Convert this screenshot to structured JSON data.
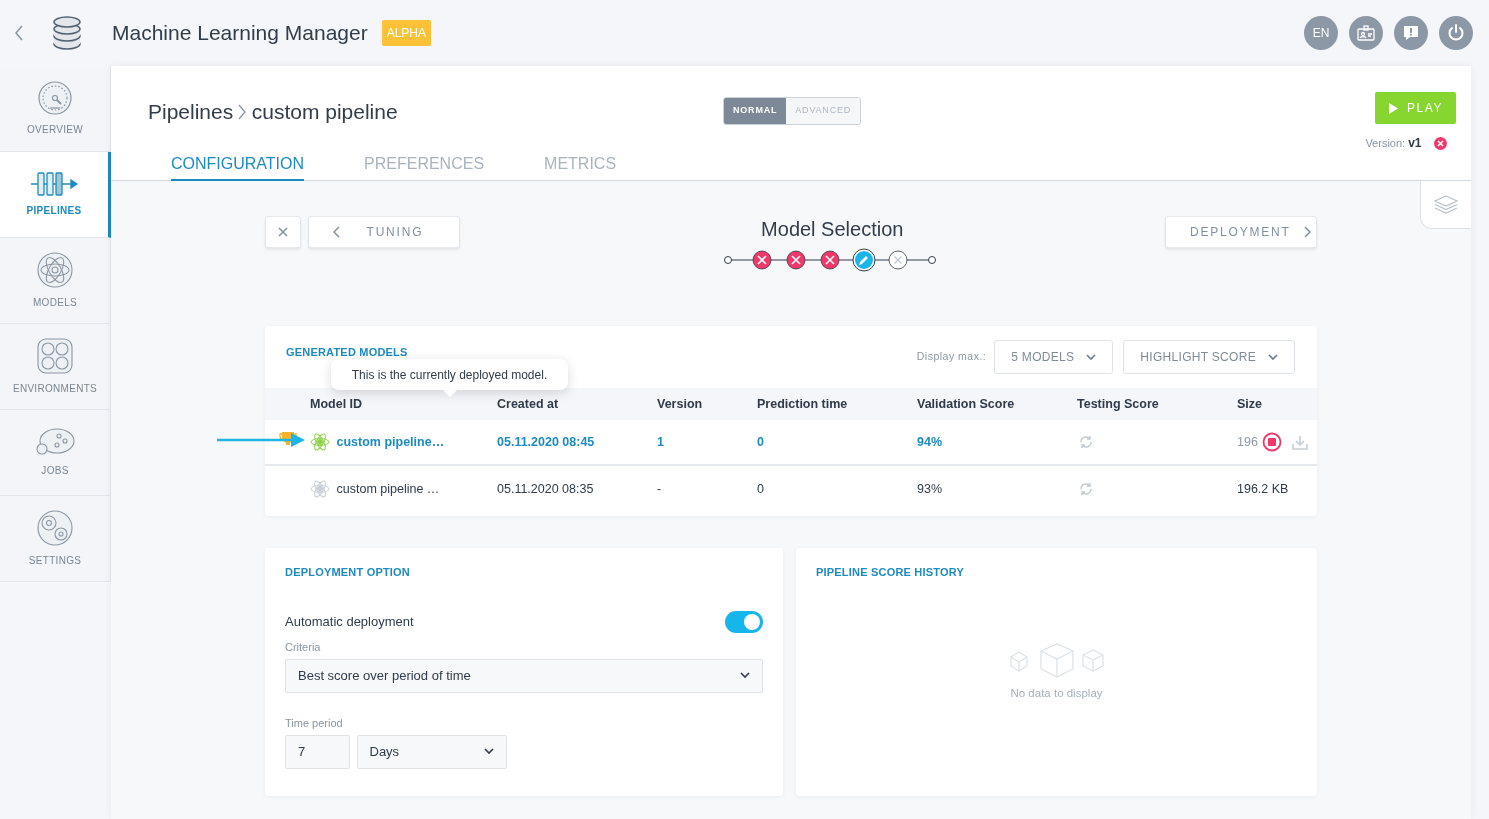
{
  "app": {
    "title": "Machine Learning Manager",
    "badge": "ALPHA"
  },
  "language_button": "EN",
  "sidebar": {
    "items": [
      {
        "label": "OVERVIEW",
        "selected": false
      },
      {
        "label": "PIPELINES",
        "selected": true
      },
      {
        "label": "MODELS",
        "selected": false
      },
      {
        "label": "ENVIRONMENTS",
        "selected": false
      },
      {
        "label": "JOBS",
        "selected": false
      },
      {
        "label": "SETTINGS",
        "selected": false
      }
    ]
  },
  "breadcrumb": [
    "Pipelines",
    "custom pipeline"
  ],
  "mode_toggle": [
    {
      "label": "NORMAL",
      "selected": true
    },
    {
      "label": "ADVANCED",
      "selected": false
    }
  ],
  "play_button": "PLAY",
  "version": {
    "label": "Version:",
    "value": "v1"
  },
  "tabs": [
    {
      "label": "CONFIGURATION",
      "selected": true
    },
    {
      "label": "PREFERENCES",
      "selected": false
    },
    {
      "label": "METRICS",
      "selected": false
    }
  ],
  "wizard": {
    "back_button": "TUNING",
    "title": "Model Selection",
    "next_button": "DEPLOYMENT",
    "steps": [
      {
        "kind": "end"
      },
      {
        "kind": "error"
      },
      {
        "kind": "error"
      },
      {
        "kind": "error"
      },
      {
        "kind": "current"
      },
      {
        "kind": "pending"
      },
      {
        "kind": "end"
      }
    ]
  },
  "models": {
    "title": "GENERATED MODELS",
    "display_label": "Display max.:",
    "display_select": "5 MODELS",
    "highlight_select": "HIGHLIGHT SCORE",
    "tooltip": "This is the currently deployed model.",
    "columns": [
      "Model ID",
      "Created at",
      "Version",
      "Prediction time",
      "Validation Score",
      "Testing Score",
      "Size"
    ],
    "rows": [
      {
        "deployed": true,
        "model_id": "custom pipeline…",
        "created_at": "05.11.2020 08:45",
        "version": "1",
        "prediction_time": "0",
        "validation_score": "94%",
        "size": "196"
      },
      {
        "deployed": false,
        "model_id": "custom pipeline …",
        "created_at": "05.11.2020 08:35",
        "version": "-",
        "prediction_time": "0",
        "validation_score": "93%",
        "size": "196.2 KB"
      }
    ]
  },
  "deployment_option": {
    "title": "DEPLOYMENT OPTION",
    "auto_label": "Automatic deployment",
    "auto_on": true,
    "criteria_label": "Criteria",
    "criteria_value": "Best score over period of time",
    "time_label": "Time period",
    "time_value": "7",
    "time_unit": "Days"
  },
  "score_history": {
    "title": "PIPELINE SCORE HISTORY",
    "empty_text": "No data to display"
  }
}
